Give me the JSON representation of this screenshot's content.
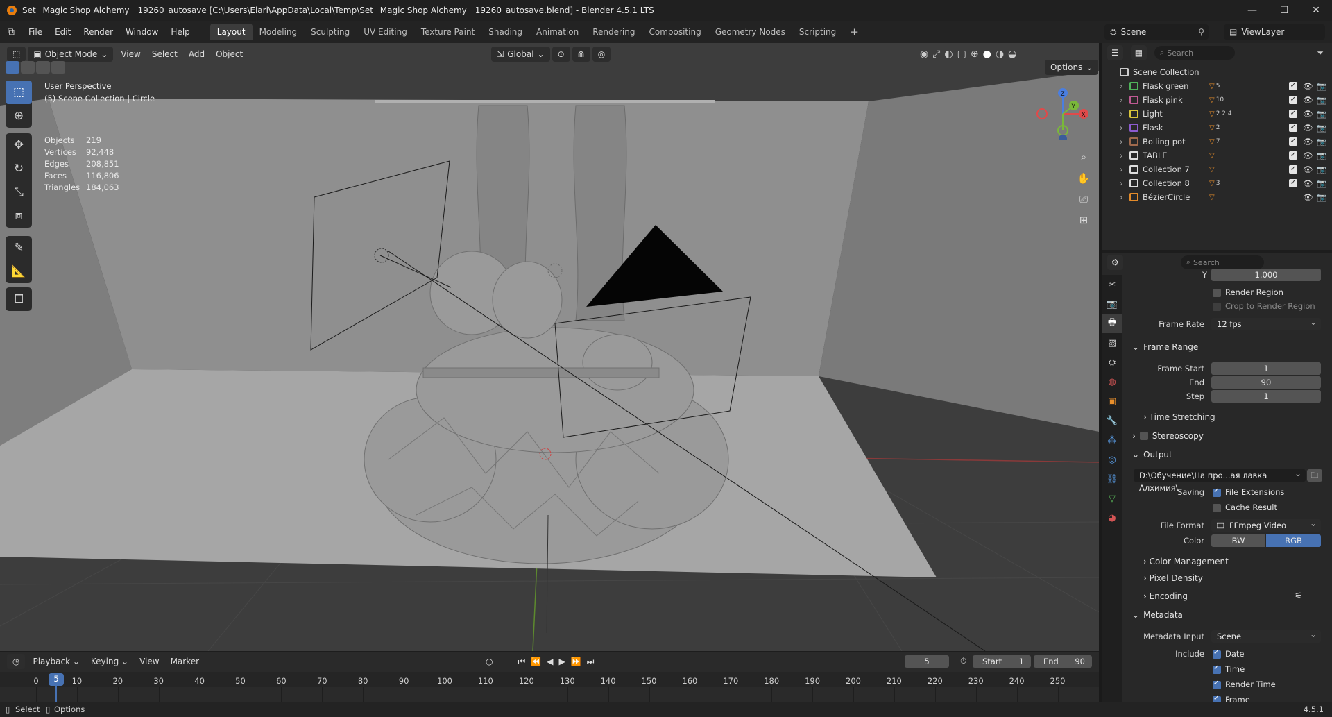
{
  "window": {
    "title": "Set _Magic Shop Alchemy__19260_autosave [C:\\Users\\Elari\\AppData\\Local\\Temp\\Set _Magic Shop Alchemy__19260_autosave.blend] - Blender 4.5.1 LTS",
    "min": "—",
    "max": "☐",
    "close": "✕"
  },
  "menu": [
    "File",
    "Edit",
    "Render",
    "Window",
    "Help"
  ],
  "workspaces": [
    "Layout",
    "Modeling",
    "Sculpting",
    "UV Editing",
    "Texture Paint",
    "Shading",
    "Animation",
    "Rendering",
    "Compositing",
    "Geometry Nodes",
    "Scripting"
  ],
  "workspace_add": "+",
  "scene": {
    "name": "Scene",
    "viewlayer": "ViewLayer"
  },
  "viewport": {
    "mode": "Object Mode",
    "menus": [
      "View",
      "Select",
      "Add",
      "Object"
    ],
    "transform": "Global",
    "options": "Options",
    "perspective": "User Perspective",
    "collection_info": "(5) Scene Collection | Circle",
    "stats": [
      {
        "k": "Objects",
        "v": "219"
      },
      {
        "k": "Vertices",
        "v": "92,448"
      },
      {
        "k": "Edges",
        "v": "208,851"
      },
      {
        "k": "Faces",
        "v": "116,806"
      },
      {
        "k": "Triangles",
        "v": "184,063"
      }
    ],
    "gizmo": {
      "x": "X",
      "y": "Y",
      "z": "Z"
    }
  },
  "outliner": {
    "search_placeholder": "Search",
    "root": "Scene Collection",
    "items": [
      {
        "name": "Flask green",
        "color": "#4fb35a",
        "badge": "5"
      },
      {
        "name": "Flask pink",
        "color": "#c05a94",
        "badge": "10"
      },
      {
        "name": "Light",
        "color": "#d9c53b",
        "badge": "2 2 4"
      },
      {
        "name": "Flask",
        "color": "#8c5bd0",
        "badge": "2"
      },
      {
        "name": "Boiling pot",
        "color": "#a06a4d",
        "badge": "7"
      },
      {
        "name": "TABLE",
        "color": "#dddddd",
        "badge": ""
      },
      {
        "name": "Collection 7",
        "color": "#dddddd",
        "badge": ""
      },
      {
        "name": "Collection 8",
        "color": "#dddddd",
        "badge": "3"
      },
      {
        "name": "BézierCircle",
        "color": "#e38b2a",
        "badge": ""
      }
    ]
  },
  "properties": {
    "search_placeholder": "Search",
    "y_label": "Y",
    "y_value": "1.000",
    "render_region": "Render Region",
    "crop_region": "Crop to Render Region",
    "frame_rate_label": "Frame Rate",
    "frame_rate": "12 fps",
    "frame_range": "Frame Range",
    "frame_start_label": "Frame Start",
    "frame_start": "1",
    "end_label": "End",
    "end": "90",
    "step_label": "Step",
    "step": "1",
    "time_stretching": "Time Stretching",
    "stereoscopy": "Stereoscopy",
    "output": "Output",
    "output_path": "D:\\Обучение\\На про...ая лавка  Алхимия\\",
    "saving_label": "Saving",
    "file_extensions": "File Extensions",
    "cache_result": "Cache Result",
    "file_format_label": "File Format",
    "file_format": "FFmpeg Video",
    "color_label": "Color",
    "bw": "BW",
    "rgb": "RGB",
    "color_management": "Color Management",
    "pixel_density": "Pixel Density",
    "encoding": "Encoding",
    "metadata": "Metadata",
    "metadata_input_label": "Metadata Input",
    "metadata_input": "Scene",
    "include_label": "Include",
    "include": [
      "Date",
      "Time",
      "Render Time",
      "Frame"
    ]
  },
  "timeline": {
    "menus": [
      "Playback",
      "Keying",
      "View",
      "Marker"
    ],
    "current_frame": "5",
    "start_label": "Start",
    "start": "1",
    "end_label": "End",
    "end": "90",
    "ticks": [
      "0",
      "5",
      "10",
      "20",
      "30",
      "40",
      "50",
      "60",
      "70",
      "80",
      "90",
      "100",
      "110",
      "120",
      "130",
      "140",
      "150",
      "160",
      "170",
      "180",
      "190",
      "200",
      "210",
      "220",
      "230",
      "240",
      "250"
    ]
  },
  "statusbar": {
    "select": "Select",
    "options": "Options",
    "version": "4.5.1"
  }
}
